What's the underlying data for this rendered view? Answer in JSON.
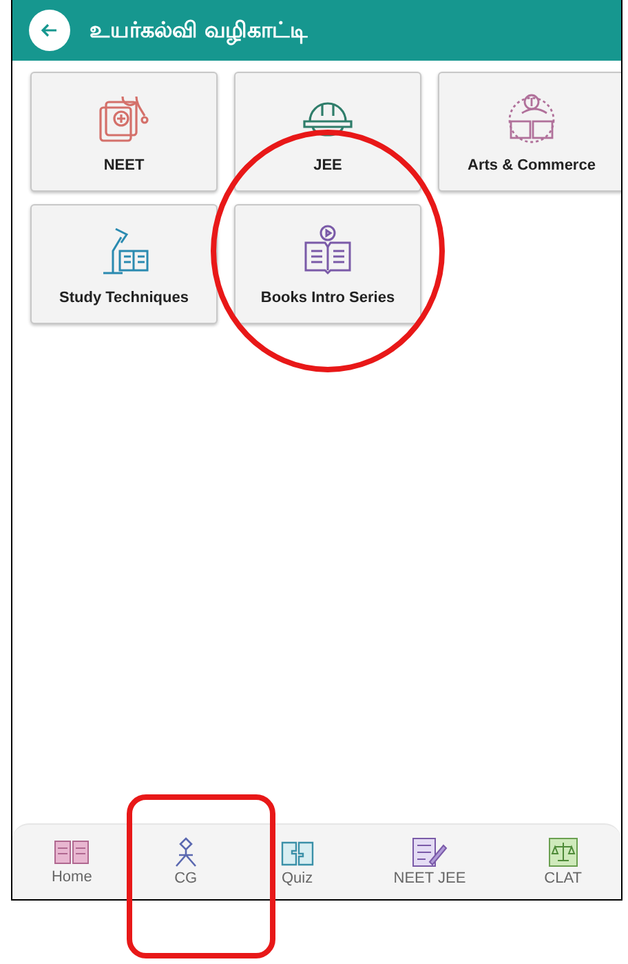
{
  "header": {
    "title": "உயர்கல்வி வழிகாட்டி"
  },
  "tiles": [
    {
      "label": "NEET",
      "kind": "medical"
    },
    {
      "label": "JEE",
      "kind": "helmet"
    },
    {
      "label": "Arts & Commerce",
      "kind": "arts"
    },
    {
      "label": "Study Techniques",
      "kind": "lamp"
    },
    {
      "label": "Books Intro Series",
      "kind": "book"
    }
  ],
  "bottom_nav": [
    {
      "label": "Home",
      "kind": "home"
    },
    {
      "label": "CG",
      "kind": "cg"
    },
    {
      "label": "Quiz",
      "kind": "quiz"
    },
    {
      "label": "NEET JEE",
      "kind": "exam"
    },
    {
      "label": "CLAT",
      "kind": "law"
    }
  ]
}
